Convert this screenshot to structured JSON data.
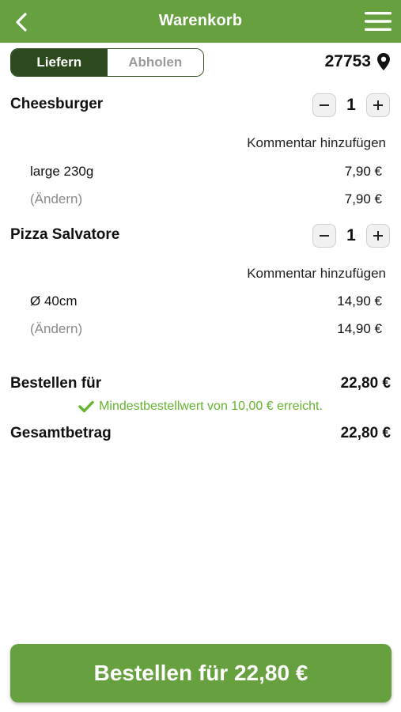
{
  "header": {
    "title": "Warenkorb",
    "back_icon": "chevron-left-icon",
    "menu_icon": "hamburger-menu-icon"
  },
  "delivery_toggle": {
    "options": [
      "Liefern",
      "Abholen"
    ],
    "selected": "Liefern"
  },
  "location": {
    "zip": "27753",
    "icon": "location-pin-icon"
  },
  "items": [
    {
      "name": "Cheesburger",
      "quantity": "1",
      "comment_label": "Kommentar hinzufügen",
      "option_label": "large 230g",
      "option_price": "7,90 €",
      "change_label": "(Ändern)",
      "total_price": "7,90 €"
    },
    {
      "name": "Pizza Salvatore",
      "quantity": "1",
      "comment_label": "Kommentar hinzufügen",
      "option_label": "Ø 40cm",
      "option_price": "14,90 €",
      "change_label": "(Ändern)",
      "total_price": "14,90 €"
    }
  ],
  "summary": {
    "order_for_label": "Bestellen für",
    "order_for_value": "22,80 €",
    "min_order_note": "Mindestbestellwert von 10,00 € erreicht.",
    "total_label": "Gesamtbetrag",
    "total_value": "22,80 €"
  },
  "order_button": {
    "label": "Bestellen für 22,80 €"
  },
  "colors": {
    "header_green": "#67a03f",
    "dark_green": "#2d4a1f",
    "success_green": "#65b32e"
  }
}
